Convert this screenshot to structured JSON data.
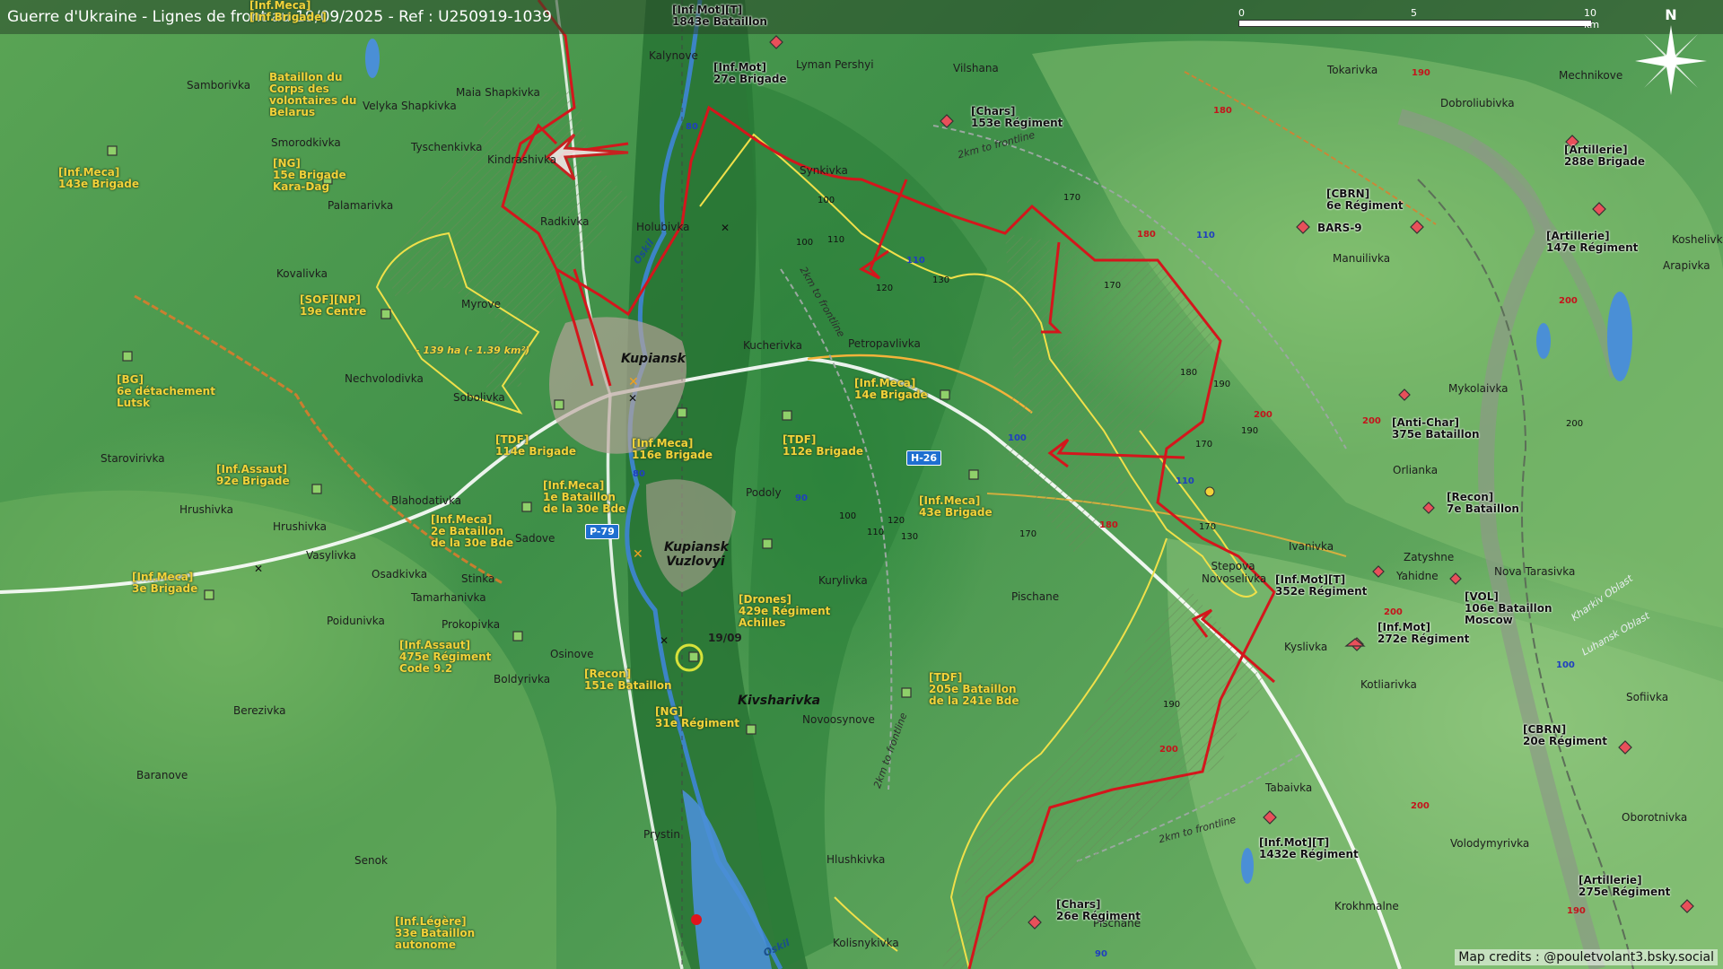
{
  "title": "Guerre d'Ukraine - Lignes de front au 19/09/2025 - Ref : U250919-1039",
  "scale": {
    "labels": [
      "0",
      "5",
      "10 km"
    ]
  },
  "north_label": "N",
  "credits": "Map credits : @pouletvolant3.bsky.social",
  "date_marker": "19/09",
  "area_note": "- 139 ha (- 1.39 km²)",
  "frontline_notes": [
    "2km to frontline",
    "2km to frontline",
    "2km to frontline",
    "2km to frontline"
  ],
  "oblast_labels": [
    "Kharkiv Oblast",
    "Luhansk Oblast"
  ],
  "river_label": "Oskil",
  "roads": [
    "P-79",
    "H-26"
  ],
  "places": {
    "kupiansk": "Kupiansk",
    "kupiansk_vuzlovyi": "Kupiansk Vuzlovyi",
    "kivsharivka": "Kivsharivka",
    "samborivka": "Samborivka",
    "maia_shapkivka": "Maia Shapkivka",
    "velyka_shapkivka": "Velyka Shapkivka",
    "tyschenkivka": "Tyschenkivka",
    "smorodkivka": "Smorodkivka",
    "kindrashivka": "Kindrashivka",
    "palamarivka": "Palamarivka",
    "radkivka": "Radkivka",
    "holubivka": "Holubivka",
    "kovalivka": "Kovalivka",
    "myrove": "Myrove",
    "nechvolodivka": "Nechvolodivka",
    "sobolivka": "Sobolivka",
    "starovirivka": "Starovirivka",
    "hrushivka": "Hrushivka",
    "blahodativka": "Blahodativka",
    "sadove": "Sadove",
    "vasylivka": "Vasylivka",
    "osadkivka": "Osadkivka",
    "stinka": "Stinka",
    "tamarhanivka": "Tamarhanivka",
    "poidunivka": "Poidunivka",
    "prokopivka": "Prokopivka",
    "osinove": "Osinove",
    "boldyrivka": "Boldyrivka",
    "berezivka": "Berezivka",
    "baranove": "Baranove",
    "senok": "Senok",
    "prystin": "Prystin",
    "kalynove": "Kalynove",
    "lyman_pershyi": "Lyman Pershyi",
    "vilshana": "Vilshana",
    "synkivka": "Synkivka",
    "kucherivka": "Kucherivka",
    "petropavlivka": "Petropavlivka",
    "podoly": "Podoly",
    "kurylivka": "Kurylivka",
    "novoosynove": "Novoosynove",
    "hlushkivka": "Hlushkivka",
    "kolisnykivka": "Kolisnykivka",
    "pischane": "Pischane",
    "stepova_novoselivka": "Stepova Novoselivka",
    "ivanivka": "Ivanivka",
    "kyslivka": "Kyslivka",
    "kotlarivka": "Kotliarivka",
    "tabaivka": "Tabaivka",
    "krokhmalne": "Krokhmalne",
    "pischane2": "Pischane",
    "tokarivka": "Tokarivka",
    "dobroliubivka": "Dobroliubivka",
    "mechnikove": "Mechnikove",
    "manuilivka": "Manuilivka",
    "koshelivka": "Koshelivka",
    "arapivka": "Arapivka",
    "mykolaivka": "Mykolaivka",
    "orlianka": "Orlianka",
    "zatyshne": "Zatyshne",
    "yahidne": "Yahidne",
    "nova_tarasivka": "Nova Tarasivka",
    "sofiivka": "Sofiivka",
    "oborotnivka": "Oborotnivka",
    "volodymyrivka": "Volodymyrivka"
  },
  "units": [
    {
      "text": "[Inf.Meca]\n[Inf.Brigade]",
      "id": "u_top_left"
    },
    {
      "text": "Bataillon du\nCorps des\nvolontaires du\nBelarus"
    },
    {
      "text": "[Inf.Meca]\n143e Brigade"
    },
    {
      "text": "[NG]\n15e Brigade\nKara-Dag"
    },
    {
      "text": "[SOF][NP]\n19e Centre"
    },
    {
      "text": "[BG]\n6e détachement\nLutsk"
    },
    {
      "text": "[TDF]\n114e Brigade"
    },
    {
      "text": "[Inf.Assaut]\n92e Brigade"
    },
    {
      "text": "[Inf.Meca]\n1e Bataillon\nde la 30e Bde"
    },
    {
      "text": "[Inf.Meca]\n2e Bataillon\nde la 30e Bde"
    },
    {
      "text": "[Inf.Meca]\n3e Brigade"
    },
    {
      "text": "[Inf.Assaut]\n475e Régiment\nCode 9.2"
    },
    {
      "text": "[Recon]\n151e Bataillon"
    },
    {
      "text": "[NG]\n31e Régiment"
    },
    {
      "text": "[Inf.Légère]\n33e Bataillon\nautonome"
    },
    {
      "text": "[Inf.Meca]\n116e Brigade"
    },
    {
      "text": "[TDF]\n112e Brigade"
    },
    {
      "text": "[Inf.Meca]\n14e Brigade"
    },
    {
      "text": "[Inf.Meca]\n43e Brigade"
    },
    {
      "text": "[Drones]\n429e Régiment\nAchilles"
    },
    {
      "text": "[TDF]\n205e Bataillon\nde la 241e Bde"
    },
    {
      "text": "[Inf.Mot]\n27e Brigade"
    },
    {
      "text": "[Inf.Mot][T]\n1843e Bataillon"
    },
    {
      "text": "[Chars]\n153e Régiment"
    },
    {
      "text": "[CBRN]\n6e Régiment"
    },
    {
      "text": "BARS-9"
    },
    {
      "text": "[Artillerie]\n288e Brigade"
    },
    {
      "text": "[Artillerie]\n147e Régiment"
    },
    {
      "text": "[Anti-Char]\n375e Bataillon"
    },
    {
      "text": "[Recon]\n7e Bataillon"
    },
    {
      "text": "[Inf.Mot][T]\n352e Régiment"
    },
    {
      "text": "[VOL]\n106e Bataillon\nMoscow"
    },
    {
      "text": "[Inf.Mot]\n272e Régiment"
    },
    {
      "text": "[CBRN]\n20e Régiment"
    },
    {
      "text": "[Inf.Mot][T]\n1432e Régiment"
    },
    {
      "text": "[Chars]\n26e Régiment"
    },
    {
      "text": "[Artillerie]\n275e Régiment"
    }
  ],
  "elevations": {
    "black": [
      "100",
      "110",
      "170",
      "100",
      "120",
      "130",
      "170",
      "180",
      "190",
      "170",
      "190",
      "170",
      "100",
      "120",
      "130",
      "110",
      "170",
      "190",
      "200"
    ],
    "red": [
      "190",
      "180",
      "180",
      "200",
      "200",
      "200",
      "180",
      "200",
      "200",
      "200",
      "190"
    ],
    "blue": [
      "80",
      "110",
      "110",
      "100",
      "80",
      "90",
      "100",
      "90",
      "110"
    ]
  },
  "colors": {
    "frontline": "#d4161c",
    "ukraine_zone": "#f0e04a",
    "russian_marker": "#e8505a",
    "ukrainian_marker": "#8fd06a"
  }
}
